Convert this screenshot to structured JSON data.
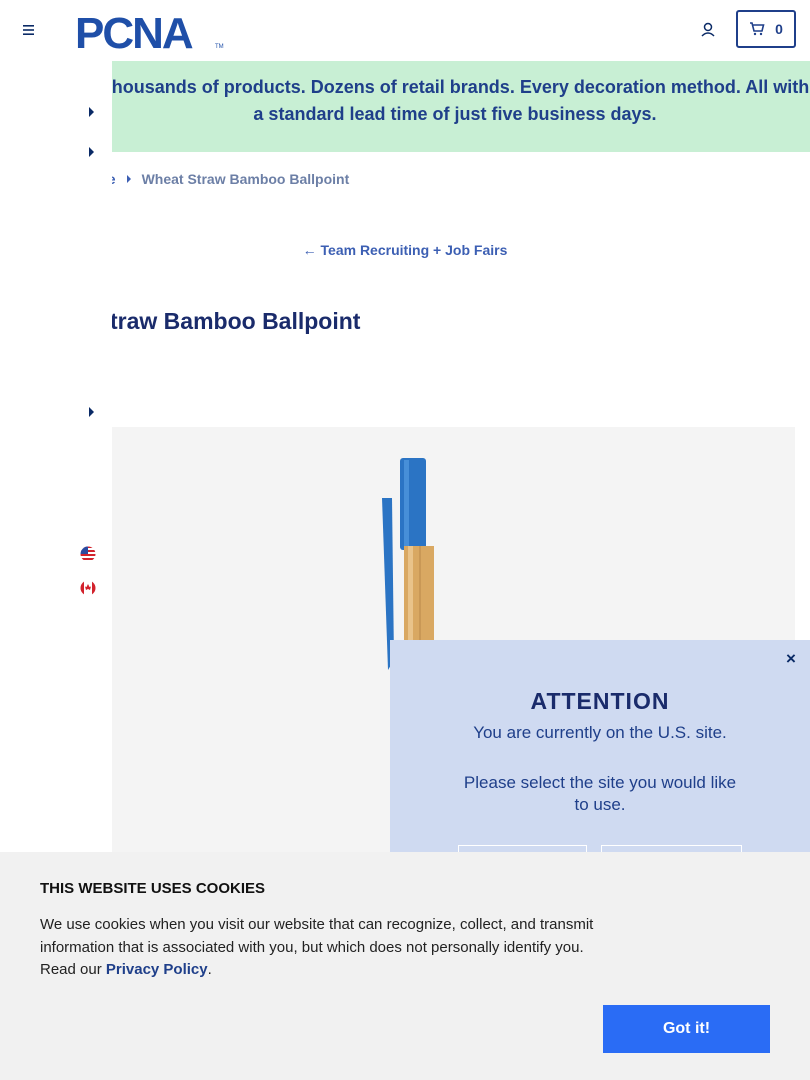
{
  "header": {
    "logo_text": "PCNA",
    "logo_tm": "TM",
    "cart_count": "0"
  },
  "banner": {
    "text": "Thousands of products. Dozens of retail brands. Every decoration method. All with a standard lead time of just five business days.",
    "color": "#c8efd4"
  },
  "breadcrumb": {
    "previous": "ce",
    "current": "Wheat Straw Bamboo Ballpoint"
  },
  "back_link": "← Team Recruiting + Job Fairs",
  "product": {
    "title": "traw Bamboo Ballpoint"
  },
  "popup": {
    "close_label": "×",
    "title": "ATTENTION",
    "message1": "You are currently on the U.S. site.",
    "message2": "Please select the site you would like to use."
  },
  "cookie": {
    "title": "THIS WEBSITE USES COOKIES",
    "body": "We use cookies when you visit our website that can recognize, collect, and transmit information that is associated with you, but which does not personally identify you. Read our ",
    "privacy_link": "Privacy Policy",
    "body_end": ".",
    "button_label": "Got it!"
  },
  "icons": {
    "menu": "hamburger-menu-icon",
    "account": "user-icon",
    "cart": "cart-icon",
    "us_flag": "us-flag-icon",
    "ca_flag": "canada-flag-icon"
  },
  "colors": {
    "brand": "#1f3f8a",
    "accent_button": "#2a6cf5",
    "popup_bg": "#cfdaf1"
  }
}
